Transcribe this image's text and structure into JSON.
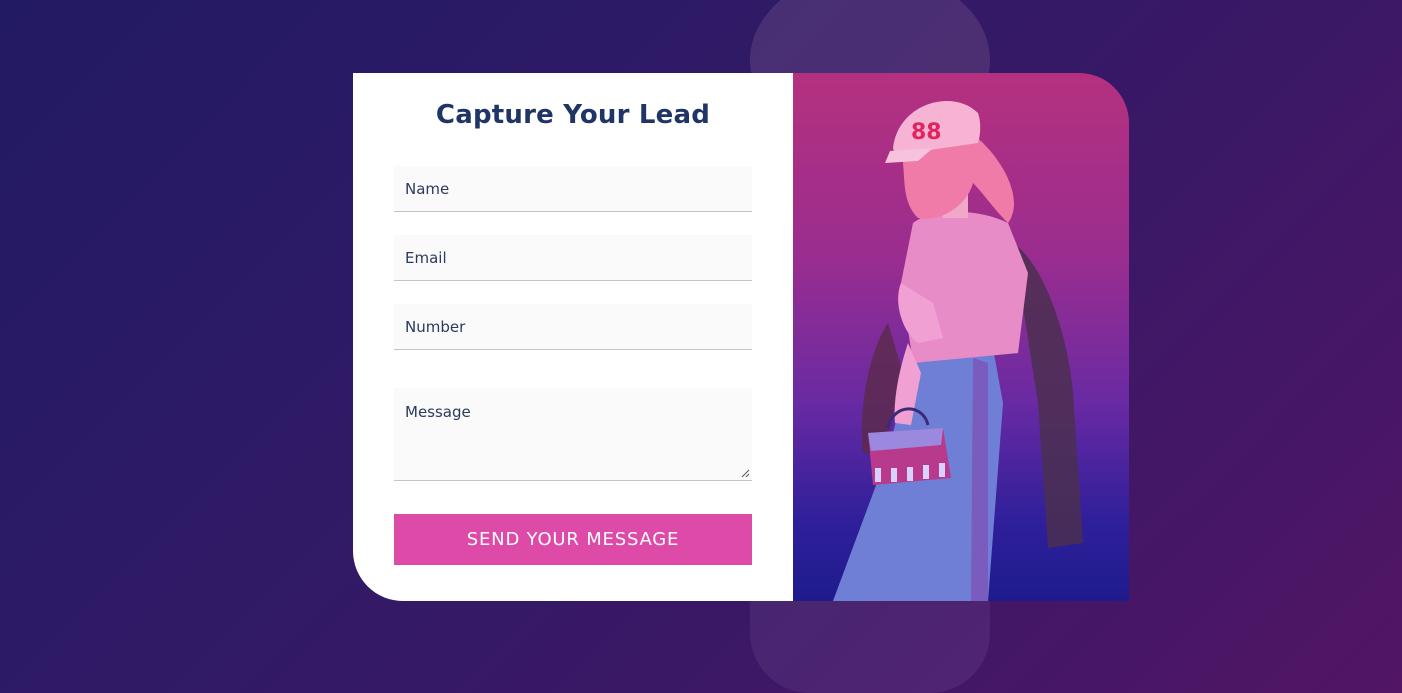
{
  "form": {
    "title": "Capture Your Lead",
    "fields": {
      "name": {
        "placeholder": "Name"
      },
      "email": {
        "placeholder": "Email"
      },
      "number": {
        "placeholder": "Number"
      },
      "message": {
        "placeholder": "Message"
      }
    },
    "submit_label": "SEND YOUR MESSAGE"
  },
  "colors": {
    "accent": "#de4aa8",
    "title": "#1f3566",
    "background_start": "#221a63",
    "background_end": "#521565"
  },
  "image": {
    "icon": "model-photo"
  }
}
